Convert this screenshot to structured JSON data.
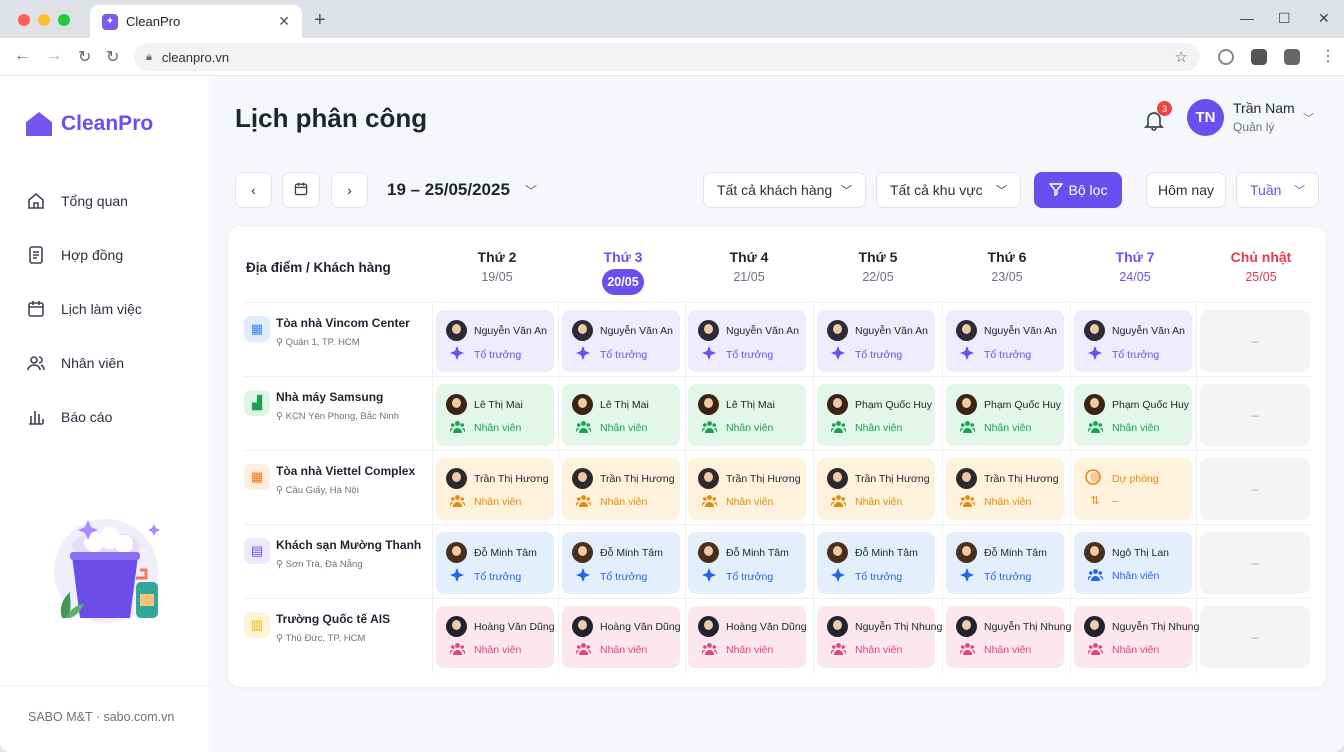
{
  "browser": {
    "tab_title": "CleanPro",
    "url": "cleanpro.vn"
  },
  "app": {
    "brand": "CleanPro",
    "footer": "SABO M&T · sabo.com.vn"
  },
  "sidebar": {
    "items": [
      {
        "label": "Tổng quan",
        "icon": "home-icon"
      },
      {
        "label": "Hợp đồng",
        "icon": "document-icon"
      },
      {
        "label": "Lịch làm việc",
        "icon": "calendar-icon"
      },
      {
        "label": "Nhân viên",
        "icon": "users-icon"
      },
      {
        "label": "Báo cáo",
        "icon": "bar-chart-icon"
      }
    ]
  },
  "header": {
    "title": "Lịch phân công",
    "notification_count": "3",
    "user_initials": "TN",
    "user_name": "Trần Nam",
    "user_role": "Quản lý"
  },
  "toolbar": {
    "date_range": "19 – 25/05/2025",
    "customer_filter": "Tất cả khách hàng",
    "area_filter": "Tất cả khu vực",
    "filter_button": "Bộ lọc",
    "today_button": "Hôm nay",
    "view_select": "Tuần"
  },
  "grid": {
    "location_header": "Địa điểm / Khách hàng",
    "days": [
      {
        "name": "Thứ 2",
        "date": "19/05"
      },
      {
        "name": "Thứ 3",
        "date": "20/05"
      },
      {
        "name": "Thứ 4",
        "date": "21/05"
      },
      {
        "name": "Thứ 5",
        "date": "22/05"
      },
      {
        "name": "Thứ 6",
        "date": "23/05"
      },
      {
        "name": "Thứ 7",
        "date": "24/05"
      },
      {
        "name": "Chủ nhật",
        "date": "25/05"
      }
    ],
    "empty_mark": "–",
    "rows": [
      {
        "name": "Tòa nhà Vincom Center",
        "address": "Quận 1, TP. HCM",
        "icon": "building-icon",
        "icon_color": "#3b82f6",
        "icon_bg": "#e0edff",
        "cells": [
          {
            "name": "Nguyễn Văn An",
            "role": "Tổ trưởng",
            "kind": "leader",
            "color": "purple"
          },
          {
            "name": "Nguyễn Văn An",
            "role": "Tổ trưởng",
            "kind": "leader",
            "color": "purple"
          },
          {
            "name": "Nguyễn Văn An",
            "role": "Tổ trưởng",
            "kind": "leader",
            "color": "purple"
          },
          {
            "name": "Nguyễn Văn An",
            "role": "Tổ trưởng",
            "kind": "leader",
            "color": "purple"
          },
          {
            "name": "Nguyễn Văn An",
            "role": "Tổ trưởng",
            "kind": "leader",
            "color": "purple"
          },
          {
            "name": "Nguyễn Văn An",
            "role": "Tổ trưởng",
            "kind": "leader",
            "color": "purple"
          }
        ]
      },
      {
        "name": "Nhà máy Samsung",
        "address": "KCN Yên Phong, Bắc Ninh",
        "icon": "factory-icon",
        "icon_color": "#16a34a",
        "icon_bg": "#dcf5e5",
        "cells": [
          {
            "name": "Lê Thị Mai",
            "role": "Nhân viên",
            "kind": "staff",
            "color": "green"
          },
          {
            "name": "Lê Thị Mai",
            "role": "Nhân viên",
            "kind": "staff",
            "color": "green"
          },
          {
            "name": "Lê Thị Mai",
            "role": "Nhân viên",
            "kind": "staff",
            "color": "green"
          },
          {
            "name": "Phạm Quốc Huy",
            "role": "Nhân viên",
            "kind": "staff",
            "color": "green"
          },
          {
            "name": "Phạm Quốc Huy",
            "role": "Nhân viên",
            "kind": "staff",
            "color": "green"
          },
          {
            "name": "Phạm Quốc Huy",
            "role": "Nhân viên",
            "kind": "staff",
            "color": "green"
          }
        ]
      },
      {
        "name": "Tòa nhà Viettel Complex",
        "address": "Cầu Giấy, Hà Nội",
        "icon": "building-icon",
        "icon_color": "#f97316",
        "icon_bg": "#ffedde",
        "cells": [
          {
            "name": "Trần Thị Hương",
            "role": "Nhân viên",
            "kind": "staff",
            "color": "orange"
          },
          {
            "name": "Trần Thị Hương",
            "role": "Nhân viên",
            "kind": "staff",
            "color": "orange"
          },
          {
            "name": "Trần Thị Hương",
            "role": "Nhân viên",
            "kind": "staff",
            "color": "orange"
          },
          {
            "name": "Trần Thị Hương",
            "role": "Nhân viên",
            "kind": "staff",
            "color": "orange"
          },
          {
            "name": "Trần Thị Hương",
            "role": "Nhân viên",
            "kind": "staff",
            "color": "orange"
          },
          {
            "name": "Dự phòng",
            "role": "–",
            "kind": "standby",
            "color": "orange"
          }
        ]
      },
      {
        "name": "Khách sạn Mường Thanh",
        "address": "Sơn Trà, Đà Nẵng",
        "icon": "hotel-icon",
        "icon_color": "#6a4ff0",
        "icon_bg": "#ece8ff",
        "cells": [
          {
            "name": "Đỗ Minh Tâm",
            "role": "Tổ trưởng",
            "kind": "leader",
            "color": "blue"
          },
          {
            "name": "Đỗ Minh Tâm",
            "role": "Tổ trưởng",
            "kind": "leader",
            "color": "blue"
          },
          {
            "name": "Đỗ Minh Tâm",
            "role": "Tổ trưởng",
            "kind": "leader",
            "color": "blue"
          },
          {
            "name": "Đỗ Minh Tâm",
            "role": "Tổ trưởng",
            "kind": "leader",
            "color": "blue"
          },
          {
            "name": "Đỗ Minh Tâm",
            "role": "Tổ trưởng",
            "kind": "leader",
            "color": "blue"
          },
          {
            "name": "Ngô Thị Lan",
            "role": "Nhân viên",
            "kind": "staff",
            "color": "blue"
          }
        ]
      },
      {
        "name": "Trường Quốc tế AIS",
        "address": "Thủ Đức, TP. HCM",
        "icon": "school-icon",
        "icon_color": "#eab308",
        "icon_bg": "#fff5d6",
        "cells": [
          {
            "name": "Hoàng Văn Dũng",
            "role": "Nhân viên",
            "kind": "staff",
            "color": "pink"
          },
          {
            "name": "Hoàng Văn Dũng",
            "role": "Nhân viên",
            "kind": "staff",
            "color": "pink"
          },
          {
            "name": "Hoàng Văn Dũng",
            "role": "Nhân viên",
            "kind": "staff",
            "color": "pink"
          },
          {
            "name": "Nguyễn Thị Nhung",
            "role": "Nhân viên",
            "kind": "staff",
            "color": "pink"
          },
          {
            "name": "Nguyễn Thị Nhung",
            "role": "Nhân viên",
            "kind": "staff",
            "color": "pink"
          },
          {
            "name": "Nguyễn Thị Nhung",
            "role": "Nhân viên",
            "kind": "staff",
            "color": "pink"
          }
        ]
      }
    ]
  },
  "palette": {
    "accent": "#6a4ff0",
    "sunday": "#e53b4a",
    "purple": {
      "bg": "#efecfd",
      "fg": "#6a4ff0"
    },
    "green": {
      "bg": "#e3f6ea",
      "fg": "#16a34a"
    },
    "orange": {
      "bg": "#fff2dd",
      "fg": "#e58a0b"
    },
    "blue": {
      "bg": "#e3effd",
      "fg": "#2563eb"
    },
    "pink": {
      "bg": "#fde7ee",
      "fg": "#e0457b"
    }
  }
}
